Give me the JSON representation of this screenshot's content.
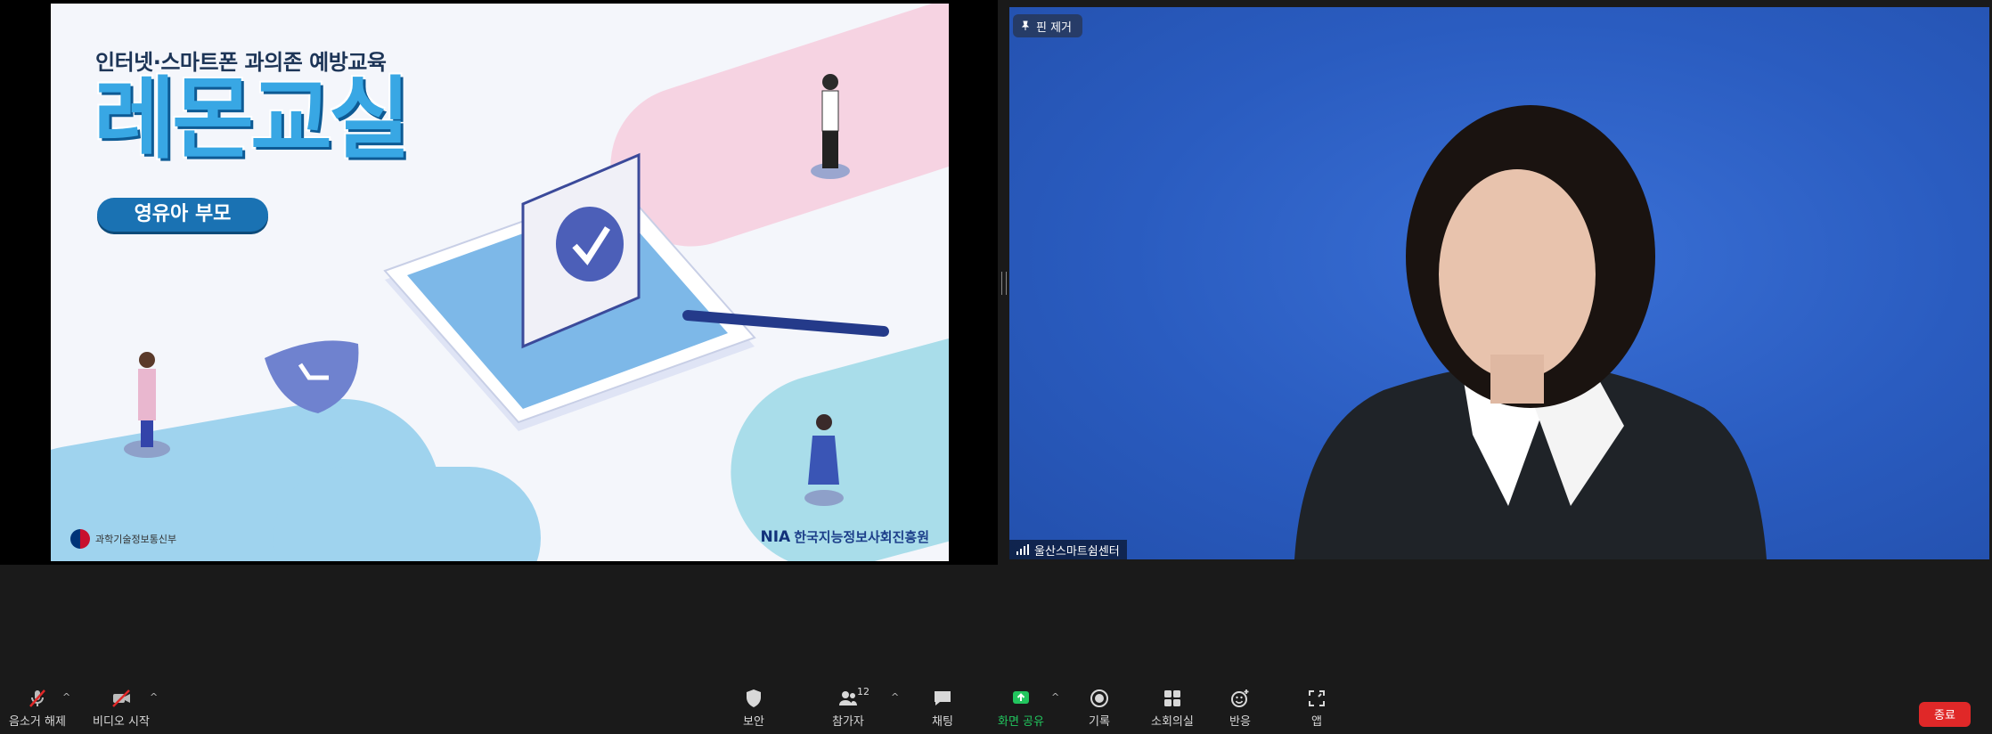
{
  "share": {
    "slide_subtitle": "인터넷·스마트폰 과의존 예방교육",
    "slide_title": "레몬교실",
    "slide_badge": "영유아 부모",
    "footer_left": "과학기술정보통신부",
    "footer_right_logo": "NIA",
    "footer_right": "한국지능정보사회진흥원"
  },
  "video": {
    "pin_label": "핀 제거",
    "participant_name": "울산스마트쉼센터"
  },
  "toolbar": {
    "mute_label": "음소거 해제",
    "video_label": "비디오 시작",
    "security_label": "보안",
    "participants_label": "참가자",
    "participants_count": "12",
    "chat_label": "채팅",
    "share_label": "화면 공유",
    "record_label": "기록",
    "breakout_label": "소회의실",
    "reactions_label": "반응",
    "apps_label": "앱",
    "end_label": "종료"
  },
  "colors": {
    "share_accent": "#22c55e",
    "end_button": "#e02828",
    "video_background": "#2b5fc2"
  }
}
